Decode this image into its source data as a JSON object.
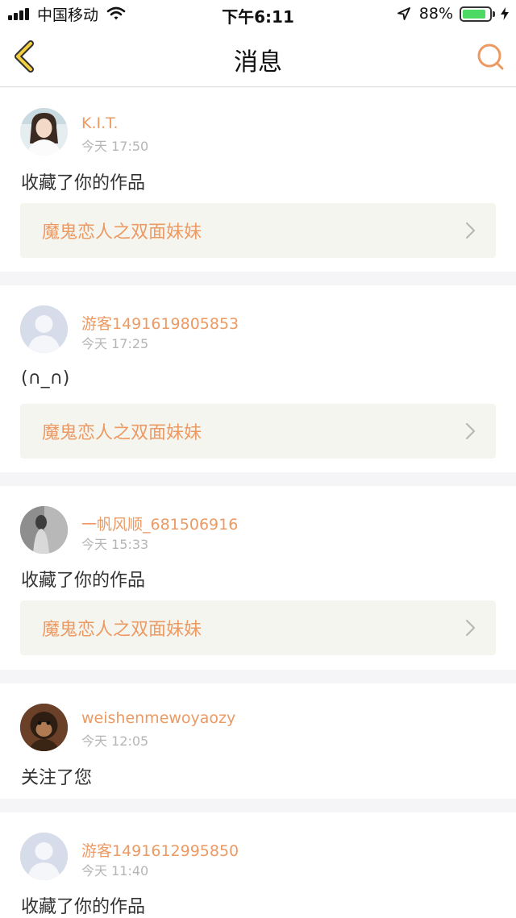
{
  "status_bar": {
    "carrier": "中国移动",
    "time": "下午6:11",
    "battery_percent": "88%",
    "battery_level": 0.88,
    "battery_color": "#4cd964"
  },
  "nav": {
    "title": "消息",
    "back_icon": "chevron-left-icon",
    "search_icon": "search-icon",
    "accent_color": "#ec9a63"
  },
  "messages": [
    {
      "username": "K.I.T.",
      "time": "今天 17:50",
      "action": "收藏了你的作品",
      "work_title": "魔鬼恋人之双面妹妹",
      "avatar": "photo-girl"
    },
    {
      "username": "游客1491619805853",
      "time": "今天 17:25",
      "action": "(∩_∩)",
      "work_title": "魔鬼恋人之双面妹妹",
      "avatar": "default-user"
    },
    {
      "username": "一帆风顺_681506916",
      "time": "今天 15:33",
      "action": "收藏了你的作品",
      "work_title": "魔鬼恋人之双面妹妹",
      "avatar": "photo-figure"
    },
    {
      "username": "weishenmewoyaozy",
      "time": "今天 12:05",
      "action": "关注了您",
      "avatar": "photo-monkey"
    },
    {
      "username": "游客1491612995850",
      "time": "今天 11:40",
      "action": "收藏了你的作品",
      "avatar": "default-user"
    }
  ]
}
